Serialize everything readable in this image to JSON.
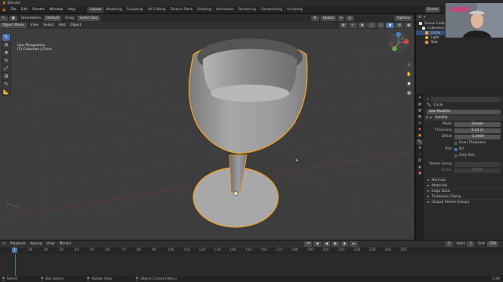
{
  "window": {
    "title": "Blender"
  },
  "menu": {
    "items": [
      "File",
      "Edit",
      "Render",
      "Window",
      "Help"
    ],
    "workspaces": [
      "Layout",
      "Modeling",
      "Sculpting",
      "UV Editing",
      "Texture Paint",
      "Shading",
      "Animation",
      "Rendering",
      "Compositing",
      "Scripting"
    ],
    "active_workspace": "Layout",
    "scene": "Scene",
    "view_layer": "View Layer"
  },
  "viewport": {
    "orientation_label": "Orientation:",
    "orientation_value": "Default",
    "drag_label": "Drag:",
    "drag_value": "Select Box",
    "mode": "Object Mode",
    "view_menus": [
      "View",
      "Select",
      "Add",
      "Object"
    ],
    "transform": "Global",
    "options_label": "Options",
    "overlay_line1": "User Perspective",
    "overlay_line2": "(1) Collection | Circle",
    "gizmo_axes": {
      "x": "X",
      "y": "Y",
      "z": "Z"
    }
  },
  "outliner": {
    "title": "Scene Collection",
    "rows": [
      {
        "label": "Scene Collection",
        "selected": false
      },
      {
        "label": "Collection",
        "selected": false
      },
      {
        "label": "Circle",
        "selected": true
      },
      {
        "label": "Light",
        "selected": false
      },
      {
        "label": "Text",
        "selected": false
      }
    ]
  },
  "properties": {
    "object_name": "Circle",
    "add_modifier": "Add Modifier",
    "modifier_name": "Solidify",
    "mode_label": "Mode",
    "mode_value": "Simple",
    "thickness_label": "Thickness",
    "thickness_value": "0.14 m",
    "offset_label": "Offset",
    "offset_value": "-1.0000",
    "even_thickness": "Even Thickness",
    "rim_label": "Rim",
    "rim_fill": "Fill",
    "only_rim": "Only Rim",
    "vertex_group_label": "Vertex Group",
    "factor_label": "Factor",
    "factor_value": "0.000",
    "subpanels": [
      "Normals",
      "Materials",
      "Edge Data",
      "Thickness Clamp",
      "Output Vertex Groups"
    ]
  },
  "timeline": {
    "menus": [
      "Playback",
      "Keying",
      "View",
      "Marker"
    ],
    "current_frame": "1",
    "start_label": "Start",
    "start": "1",
    "end_label": "End",
    "end": "250",
    "ticks": [
      "0",
      "10",
      "20",
      "30",
      "40",
      "50",
      "60",
      "70",
      "80",
      "90",
      "100",
      "110",
      "120",
      "130",
      "140",
      "150",
      "160",
      "170",
      "180",
      "190",
      "200",
      "210",
      "220",
      "230",
      "240",
      "250"
    ]
  },
  "statusbar": {
    "select": "Select",
    "box_select": "Box Select",
    "rotate_view": "Rotate View",
    "context_menu": "Object Context Menu",
    "version": "2.90"
  },
  "colors": {
    "accent": "#4b72a8",
    "selection_outline": "#f5a020",
    "glass_body": "#9c9c9c",
    "viewport_bg": "#3d3d3d"
  }
}
